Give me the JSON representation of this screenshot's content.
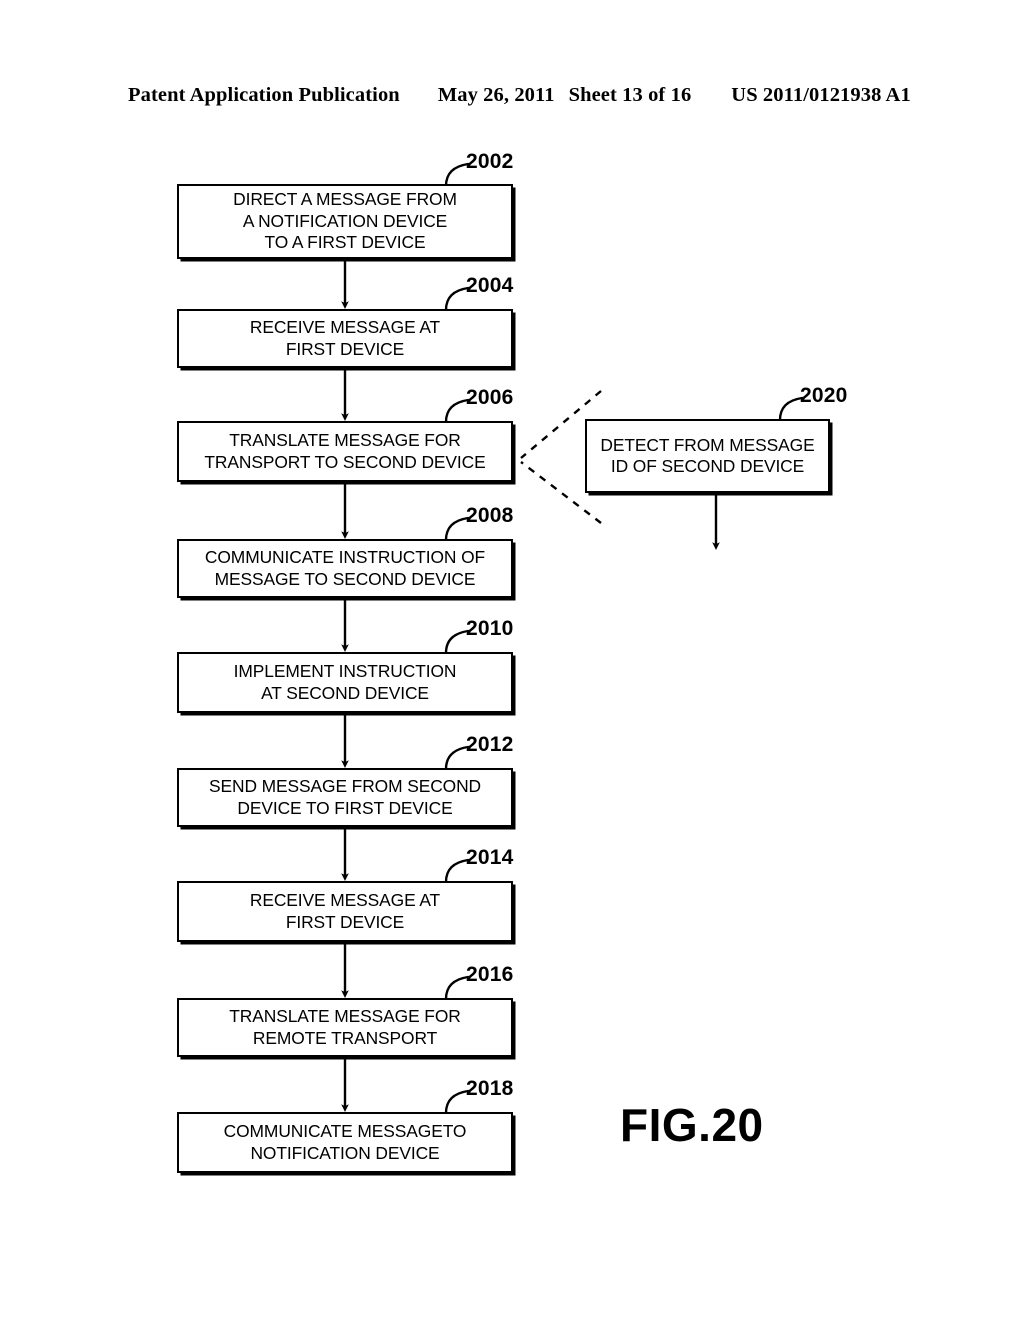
{
  "header": {
    "left": "Patent Application Publication",
    "date": "May 26, 2011",
    "sheet": "Sheet 13 of 16",
    "pub_number": "US 2011/0121938 A1"
  },
  "figure": {
    "label": "FIG.20",
    "boxes": [
      {
        "ref": "2002",
        "text": "DIRECT A MESSAGE FROM\nA NOTIFICATION DEVICE\nTO A FIRST DEVICE"
      },
      {
        "ref": "2004",
        "text": "RECEIVE MESSAGE AT\nFIRST DEVICE"
      },
      {
        "ref": "2006",
        "text": "TRANSLATE MESSAGE FOR\nTRANSPORT TO SECOND DEVICE"
      },
      {
        "ref": "2008",
        "text": "COMMUNICATE INSTRUCTION OF\nMESSAGE TO SECOND DEVICE"
      },
      {
        "ref": "2010",
        "text": "IMPLEMENT INSTRUCTION\nAT SECOND DEVICE"
      },
      {
        "ref": "2012",
        "text": "SEND MESSAGE FROM SECOND\nDEVICE TO FIRST DEVICE"
      },
      {
        "ref": "2014",
        "text": "RECEIVE MESSAGE AT\nFIRST DEVICE"
      },
      {
        "ref": "2016",
        "text": "TRANSLATE MESSAGE FOR\nREMOTE TRANSPORT"
      },
      {
        "ref": "2018",
        "text": "COMMUNICATE MESSAGETO\nNOTIFICATION DEVICE"
      }
    ],
    "side_box": {
      "ref": "2020",
      "text": "DETECT FROM MESSAGE\nID OF SECOND DEVICE"
    }
  }
}
